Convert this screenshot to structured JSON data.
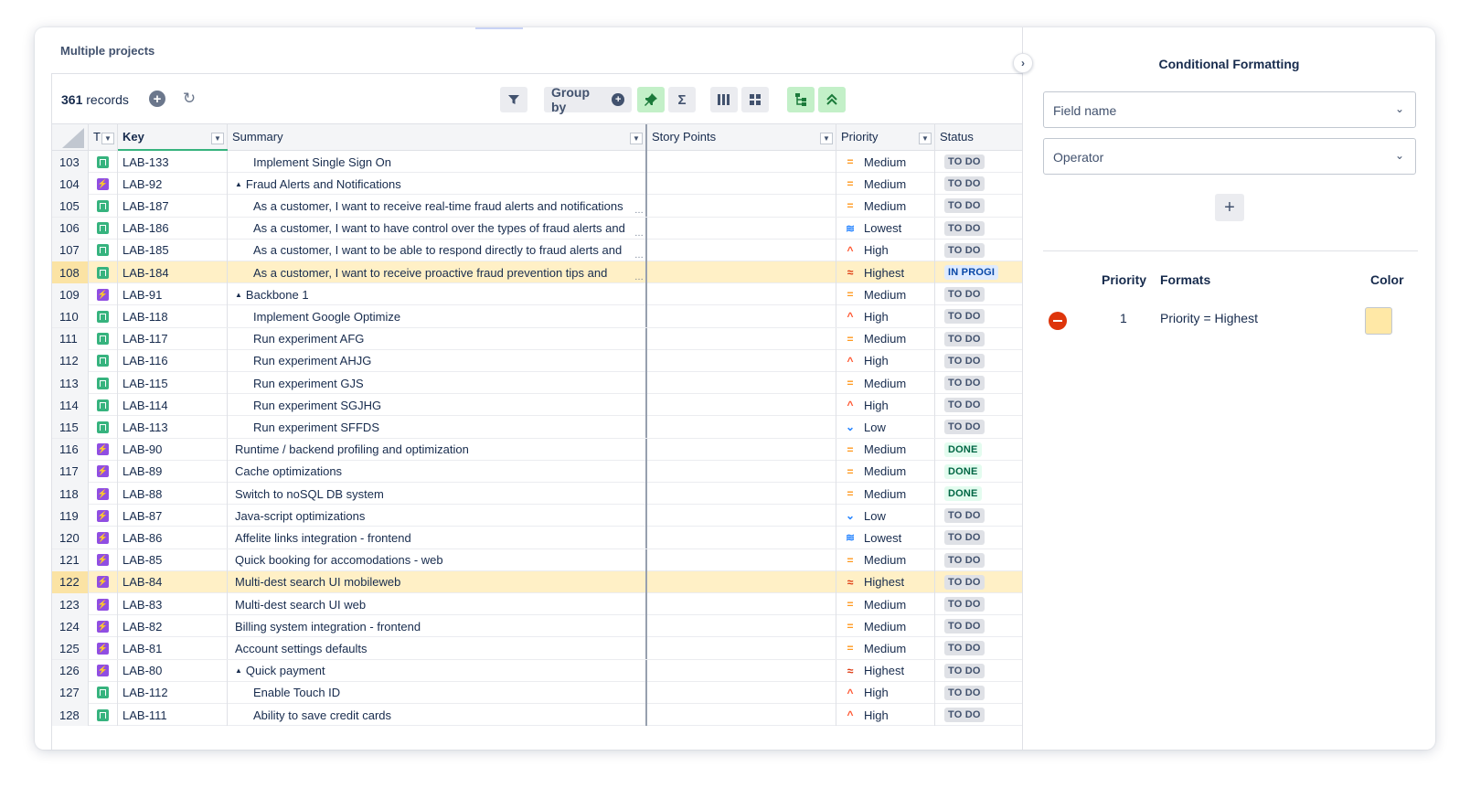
{
  "project_title": "Multiple projects",
  "toolbar": {
    "records_count": "361",
    "records_label": "records",
    "group_by_label": "Group by"
  },
  "columns": {
    "type": "T",
    "key": "Key",
    "summary": "Summary",
    "story_points": "Story Points",
    "priority": "Priority",
    "status": "Status"
  },
  "rows": [
    {
      "num": "103",
      "type": "story",
      "key": "LAB-133",
      "summary": "Implement Single Sign On",
      "indent": 2,
      "priority": "Medium",
      "status": "TO DO"
    },
    {
      "num": "104",
      "type": "epic",
      "key": "LAB-92",
      "summary": "Fraud Alerts and Notifications",
      "indent": 1,
      "expand": true,
      "priority": "Medium",
      "status": "TO DO"
    },
    {
      "num": "105",
      "type": "story",
      "key": "LAB-187",
      "summary": "As a customer, I want to receive real-time fraud alerts and notifications",
      "indent": 2,
      "ellipsis": true,
      "priority": "Medium",
      "status": "TO DO"
    },
    {
      "num": "106",
      "type": "story",
      "key": "LAB-186",
      "summary": "As a customer, I want to have control over the types of fraud alerts and",
      "indent": 2,
      "ellipsis": true,
      "priority": "Lowest",
      "status": "TO DO"
    },
    {
      "num": "107",
      "type": "story",
      "key": "LAB-185",
      "summary": "As a customer, I want to be able to respond directly to fraud alerts and",
      "indent": 2,
      "ellipsis": true,
      "priority": "High",
      "status": "TO DO"
    },
    {
      "num": "108",
      "type": "story",
      "key": "LAB-184",
      "summary": "As a customer, I want to receive proactive fraud prevention tips and",
      "indent": 2,
      "ellipsis": true,
      "priority": "Highest",
      "status": "IN PROGI",
      "highlight": true
    },
    {
      "num": "109",
      "type": "epic",
      "key": "LAB-91",
      "summary": "Backbone 1",
      "indent": 1,
      "expand": true,
      "priority": "Medium",
      "status": "TO DO"
    },
    {
      "num": "110",
      "type": "story",
      "key": "LAB-118",
      "summary": "Implement Google Optimize",
      "indent": 2,
      "priority": "High",
      "status": "TO DO"
    },
    {
      "num": "111",
      "type": "story",
      "key": "LAB-117",
      "summary": "Run experiment AFG",
      "indent": 2,
      "priority": "Medium",
      "status": "TO DO"
    },
    {
      "num": "112",
      "type": "story",
      "key": "LAB-116",
      "summary": "Run experiment AHJG",
      "indent": 2,
      "priority": "High",
      "status": "TO DO"
    },
    {
      "num": "113",
      "type": "story",
      "key": "LAB-115",
      "summary": "Run experiment GJS",
      "indent": 2,
      "priority": "Medium",
      "status": "TO DO"
    },
    {
      "num": "114",
      "type": "story",
      "key": "LAB-114",
      "summary": "Run experiment SGJHG",
      "indent": 2,
      "priority": "High",
      "status": "TO DO"
    },
    {
      "num": "115",
      "type": "story",
      "key": "LAB-113",
      "summary": "Run experiment SFFDS",
      "indent": 2,
      "priority": "Low",
      "status": "TO DO"
    },
    {
      "num": "116",
      "type": "epic",
      "key": "LAB-90",
      "summary": "Runtime / backend profiling and optimization",
      "indent": 1,
      "priority": "Medium",
      "status": "DONE"
    },
    {
      "num": "117",
      "type": "epic",
      "key": "LAB-89",
      "summary": "Cache optimizations",
      "indent": 1,
      "priority": "Medium",
      "status": "DONE"
    },
    {
      "num": "118",
      "type": "epic",
      "key": "LAB-88",
      "summary": "Switch to noSQL DB system",
      "indent": 1,
      "priority": "Medium",
      "status": "DONE"
    },
    {
      "num": "119",
      "type": "epic",
      "key": "LAB-87",
      "summary": "Java-script optimizations",
      "indent": 1,
      "priority": "Low",
      "status": "TO DO"
    },
    {
      "num": "120",
      "type": "epic",
      "key": "LAB-86",
      "summary": "Affelite links integration - frontend",
      "indent": 1,
      "priority": "Lowest",
      "status": "TO DO"
    },
    {
      "num": "121",
      "type": "epic",
      "key": "LAB-85",
      "summary": "Quick booking for accomodations - web",
      "indent": 1,
      "priority": "Medium",
      "status": "TO DO"
    },
    {
      "num": "122",
      "type": "epic",
      "key": "LAB-84",
      "summary": "Multi-dest search UI mobileweb",
      "indent": 1,
      "priority": "Highest",
      "status": "TO DO",
      "highlight": true
    },
    {
      "num": "123",
      "type": "epic",
      "key": "LAB-83",
      "summary": "Multi-dest search UI web",
      "indent": 1,
      "priority": "Medium",
      "status": "TO DO"
    },
    {
      "num": "124",
      "type": "epic",
      "key": "LAB-82",
      "summary": "Billing system integration - frontend",
      "indent": 1,
      "priority": "Medium",
      "status": "TO DO"
    },
    {
      "num": "125",
      "type": "epic",
      "key": "LAB-81",
      "summary": "Account settings defaults",
      "indent": 1,
      "priority": "Medium",
      "status": "TO DO"
    },
    {
      "num": "126",
      "type": "epic",
      "key": "LAB-80",
      "summary": "Quick payment",
      "indent": 1,
      "expand": true,
      "priority": "Highest",
      "status": "TO DO"
    },
    {
      "num": "127",
      "type": "story",
      "key": "LAB-112",
      "summary": "Enable Touch ID",
      "indent": 2,
      "priority": "High",
      "status": "TO DO"
    },
    {
      "num": "128",
      "type": "story",
      "key": "LAB-111",
      "summary": "Ability to save credit cards",
      "indent": 2,
      "priority": "High",
      "status": "TO DO"
    }
  ],
  "priority_icons": {
    "Medium": "medium-priority-icon",
    "High": "high-priority-icon",
    "Highest": "highest-priority-icon",
    "Low": "low-priority-icon",
    "Lowest": "lowest-priority-icon"
  },
  "conditional_formatting": {
    "title": "Conditional Formatting",
    "field_name_placeholder": "Field name",
    "operator_placeholder": "Operator",
    "headers": {
      "priority": "Priority",
      "formats": "Formats",
      "color": "Color"
    },
    "rules": [
      {
        "priority": "1",
        "format": "Priority = Highest",
        "color": "#ffe8a6"
      }
    ]
  },
  "colors": {
    "highlight_row": "#fff0c6",
    "accent_green": "#c3f0c8",
    "remove_red": "#de350b",
    "story_green": "#36b37e",
    "epic_purple": "#904ee2"
  }
}
